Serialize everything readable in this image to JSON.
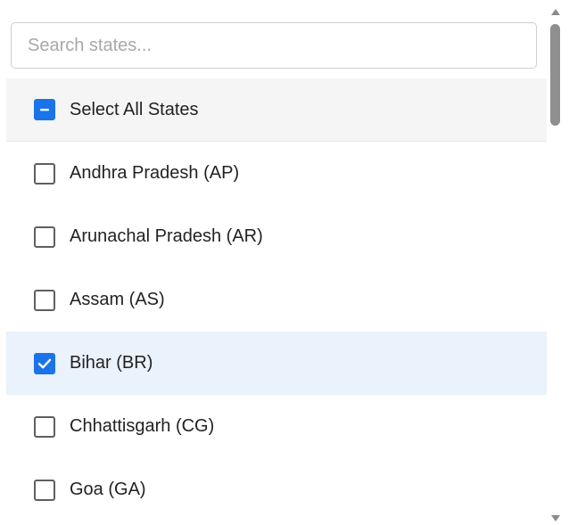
{
  "search": {
    "placeholder": "Search states...",
    "value": ""
  },
  "select_all": {
    "label": "Select All States",
    "state": "indeterminate"
  },
  "states": [
    {
      "label": "Andhra Pradesh (AP)",
      "checked": false
    },
    {
      "label": "Arunachal Pradesh (AR)",
      "checked": false
    },
    {
      "label": "Assam (AS)",
      "checked": false
    },
    {
      "label": "Bihar (BR)",
      "checked": true
    },
    {
      "label": "Chhattisgarh (CG)",
      "checked": false
    },
    {
      "label": "Goa (GA)",
      "checked": false
    }
  ],
  "icons": {
    "indeterminate": "minus-icon",
    "checked": "checkmark-icon",
    "scroll_up": "scroll-up-arrow-icon",
    "scroll_down": "scroll-down-arrow-icon"
  },
  "colors": {
    "accent": "#1a73e8",
    "checked_row_bg": "#eaf2fc",
    "select_all_bg": "#f5f5f5"
  }
}
